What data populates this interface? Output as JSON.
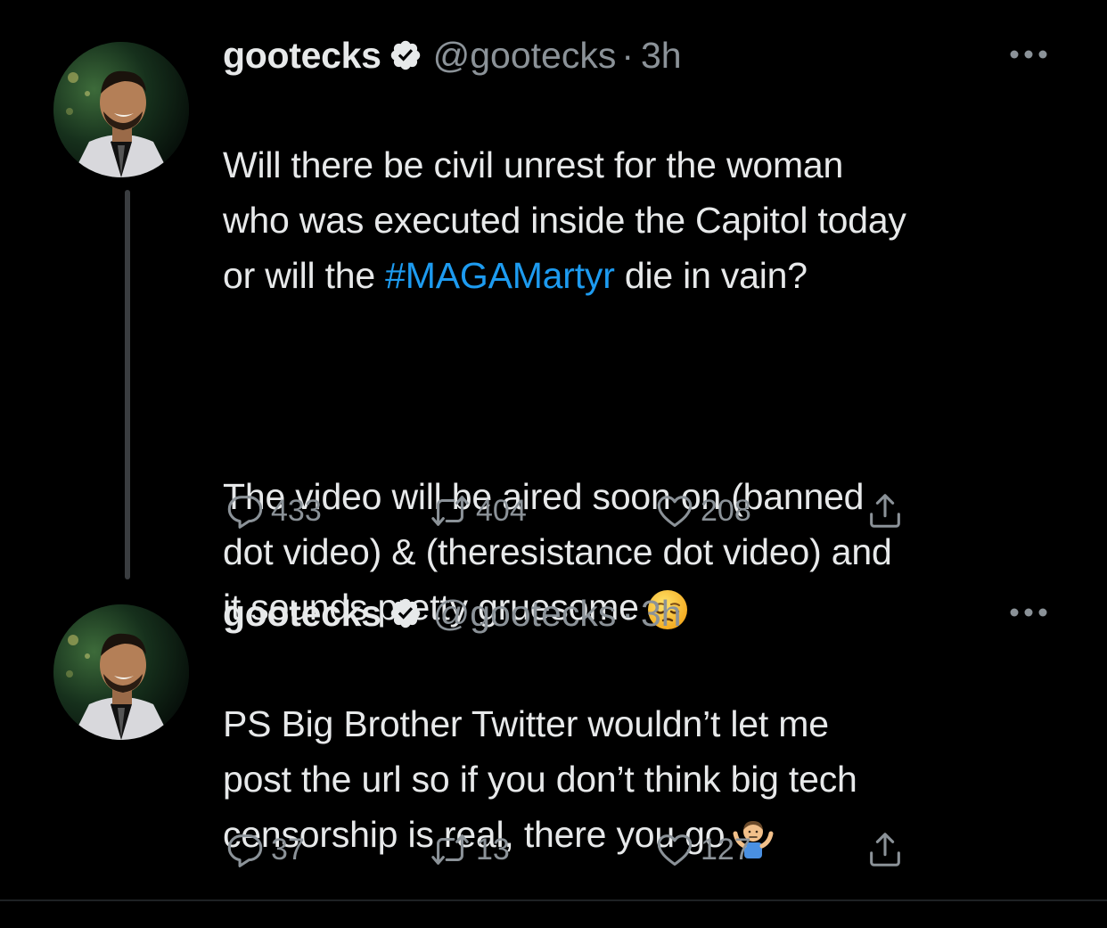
{
  "colors": {
    "background": "#000000",
    "text": "#e7e9ea",
    "muted": "#8b9298",
    "link": "#1d9bf0",
    "verified": "#e7e9ea"
  },
  "tweets": [
    {
      "display_name": "gootecks",
      "verified_icon": "verified-badge-icon",
      "handle": "@gootecks",
      "separator": "·",
      "time": "3h",
      "text_line_1_pre": "Will there be civil unrest for the woman\nwho was executed inside the Capitol today\nor will the ",
      "hashtag": "#MAGAMartyr",
      "text_line_1_post": " die in vain?",
      "text_paragraph_2": "The video will be aired soon on (banned\ndot video) & (theresistance dot video)  and\nit sounds pretty gruesome",
      "emoji": "pensive-face-emoji",
      "reply_count": "433",
      "retweet_count": "404",
      "like_count": "208"
    },
    {
      "display_name": "gootecks",
      "verified_icon": "verified-badge-icon",
      "handle": "@gootecks",
      "separator": "·",
      "time": "3h",
      "text": "PS Big Brother Twitter wouldn’t let me\npost the url so if you don’t think big tech\ncensorship is real, there you go",
      "emoji": "man-shrugging-emoji",
      "reply_count": "37",
      "retweet_count": "13",
      "like_count": "127"
    }
  ]
}
